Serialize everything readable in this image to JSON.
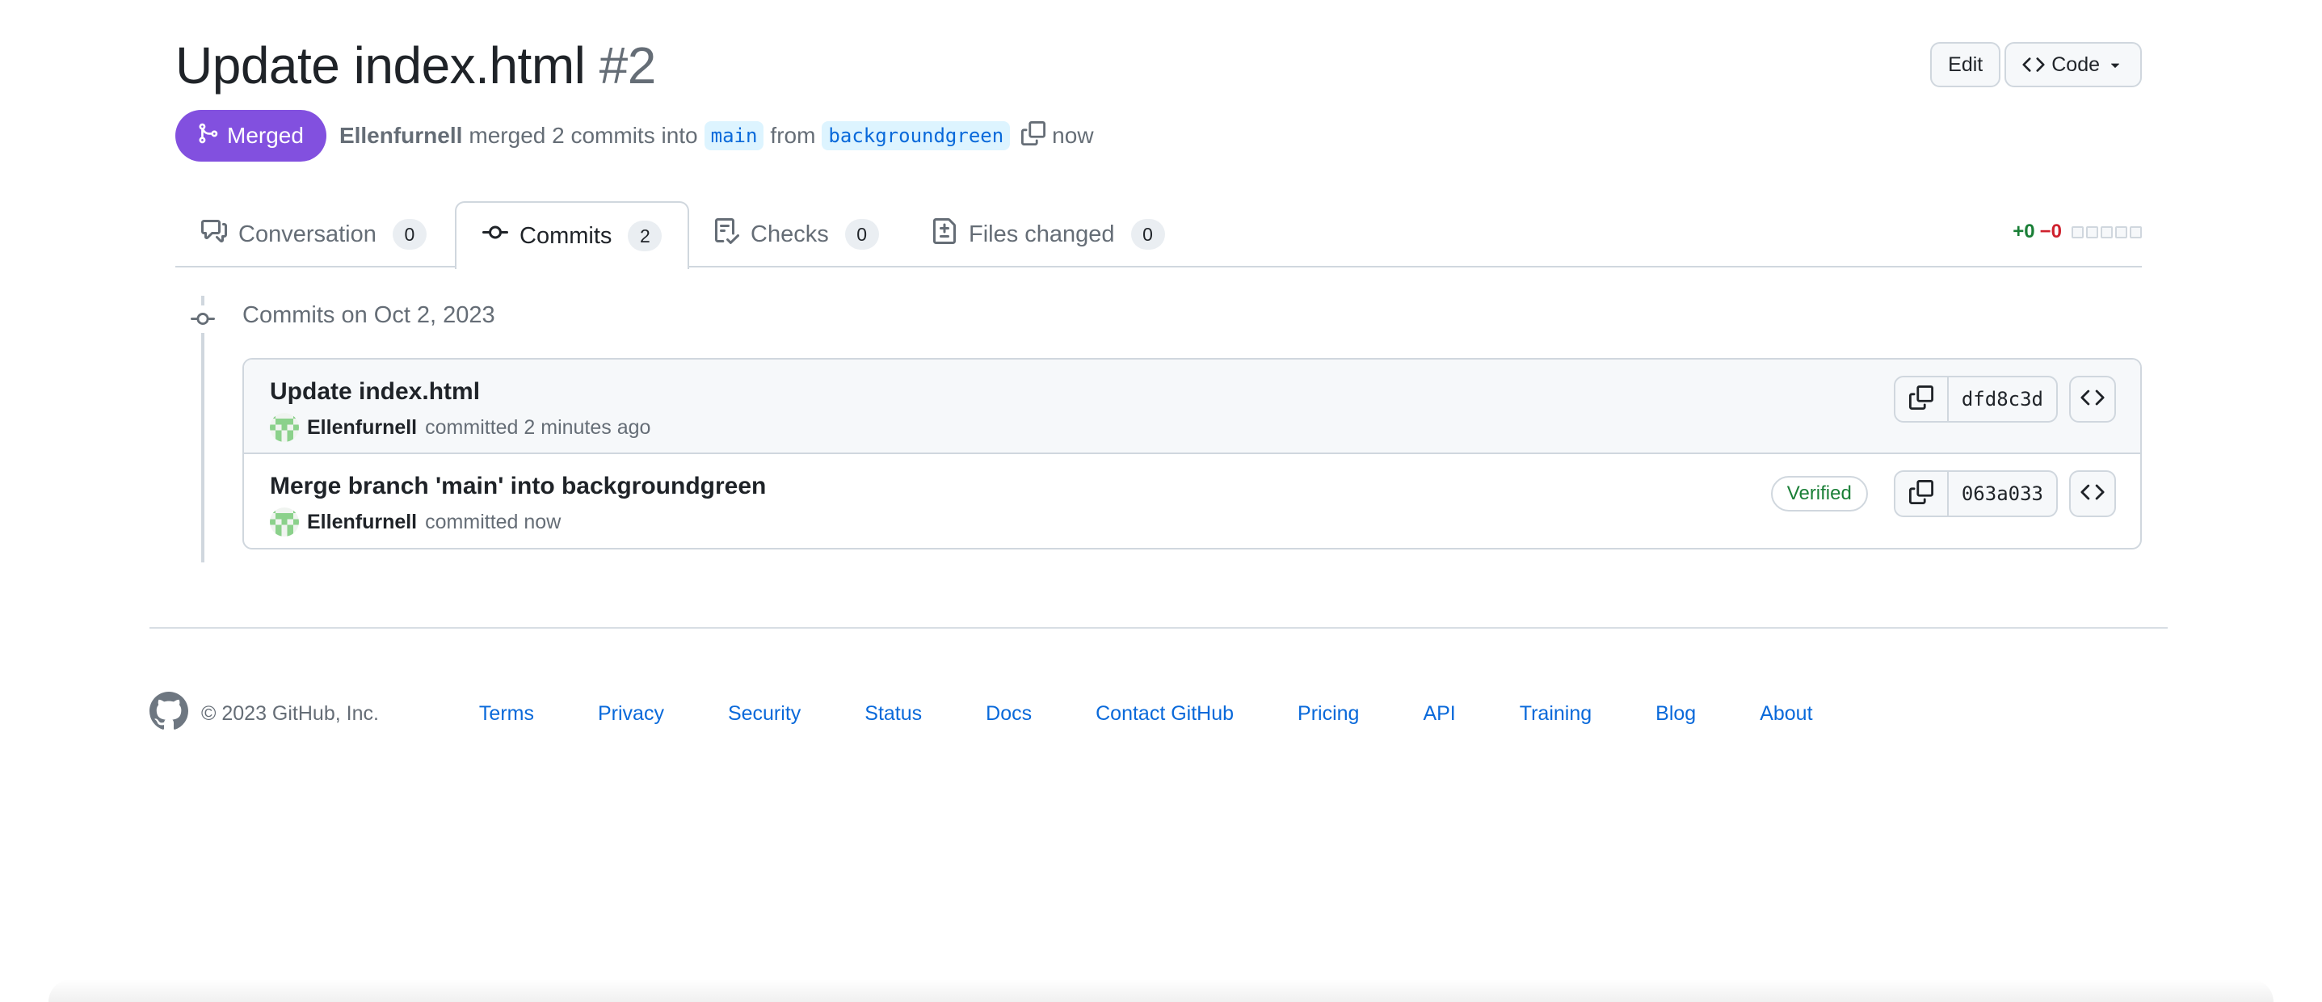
{
  "header": {
    "title": "Update index.html",
    "number": "#2",
    "edit_label": "Edit",
    "code_label": "Code"
  },
  "meta": {
    "state": "Merged",
    "author": "Ellenfurnell",
    "action_text": "merged 2 commits into",
    "base_branch": "main",
    "from_text": "from",
    "head_branch": "backgroundgreen",
    "time": "now"
  },
  "tabs": [
    {
      "label": "Conversation",
      "count": "0",
      "icon": "comment-discussion-icon"
    },
    {
      "label": "Commits",
      "count": "2",
      "icon": "git-commit-icon",
      "active": true
    },
    {
      "label": "Checks",
      "count": "0",
      "icon": "checklist-icon"
    },
    {
      "label": "Files changed",
      "count": "0",
      "icon": "file-diff-icon"
    }
  ],
  "diffstat": {
    "additions": "+0",
    "deletions": "−0"
  },
  "commits_group": {
    "title": "Commits on Oct 2, 2023"
  },
  "commits": [
    {
      "message": "Update index.html",
      "author": "Ellenfurnell",
      "action": "committed 2 minutes ago",
      "sha": "dfd8c3d",
      "verified": ""
    },
    {
      "message": "Merge branch 'main' into backgroundgreen",
      "author": "Ellenfurnell",
      "action": "committed now",
      "sha": "063a033",
      "verified": "Verified"
    }
  ],
  "footer": {
    "copyright": "© 2023 GitHub, Inc.",
    "links": [
      "Terms",
      "Privacy",
      "Security",
      "Status",
      "Docs",
      "Contact GitHub",
      "Pricing",
      "API",
      "Training",
      "Blog",
      "About"
    ]
  },
  "colors": {
    "merged": "#8250df",
    "link": "#0969da",
    "verified": "#1a7f37",
    "addition": "#1a7f37",
    "deletion": "#cf222e"
  }
}
